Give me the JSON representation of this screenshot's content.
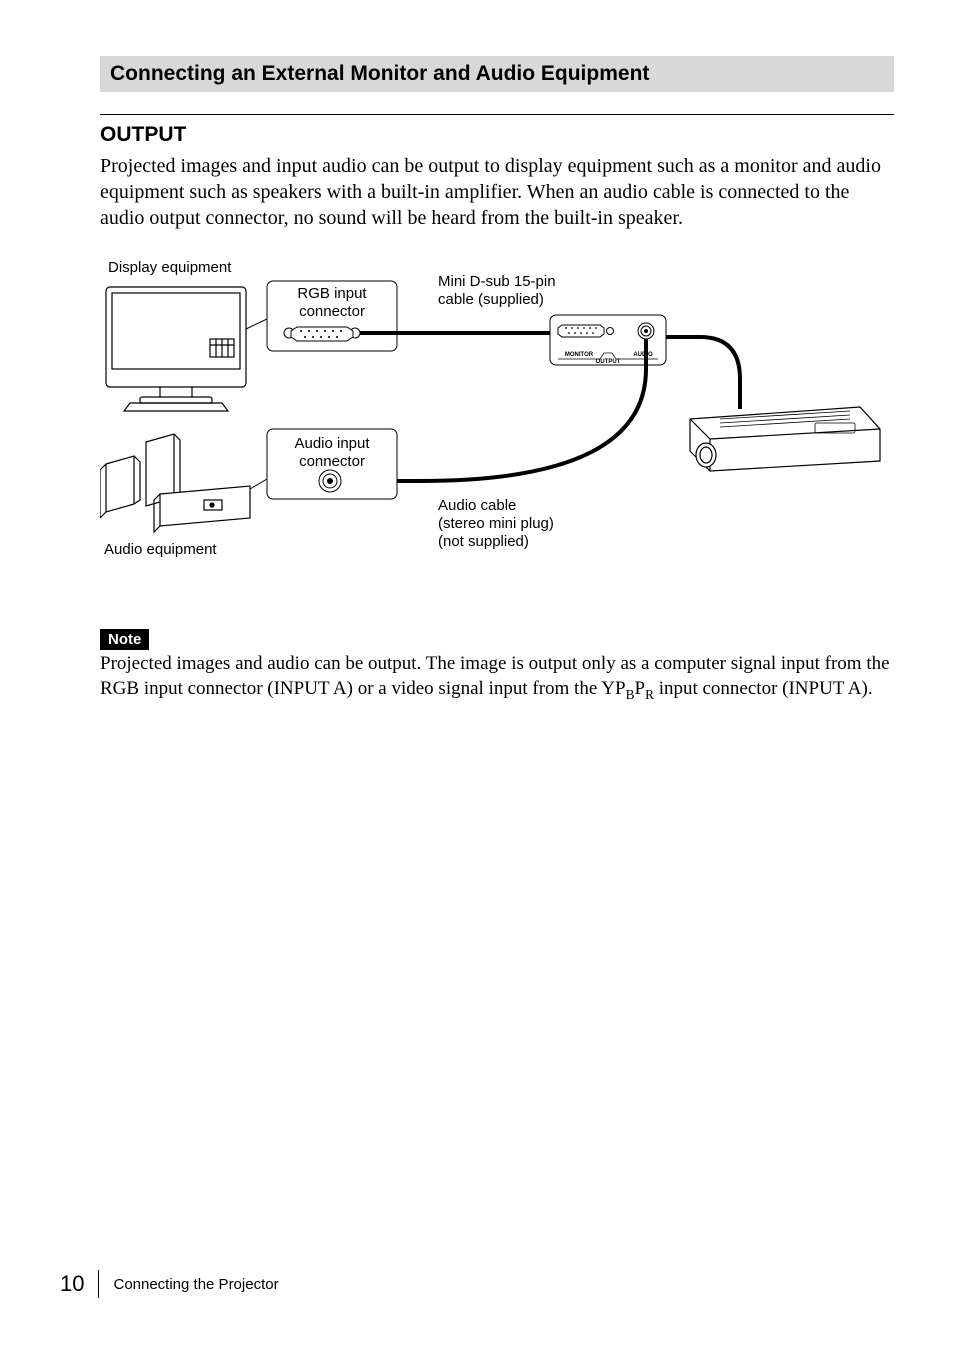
{
  "section_title": "Connecting an External Monitor and Audio Equipment",
  "sub_heading": "OUTPUT",
  "paragraph": "Projected images and input audio can be output to display equipment such as a monitor and audio equipment such as speakers with a built-in amplifier. When an audio cable is connected to the audio output connector, no sound will be heard from the built-in speaker.",
  "labels": {
    "display_eq": "Display equipment",
    "rgb_input_l1": "RGB input",
    "rgb_input_l2": "connector",
    "mini_dsub_l1": "Mini D-sub 15-pin",
    "mini_dsub_l2": "cable (supplied)",
    "audio_input_l1": "Audio input",
    "audio_input_l2": "connector",
    "audio_cable_l1": "Audio cable",
    "audio_cable_l2": "(stereo mini plug)",
    "audio_cable_l3": "(not supplied)",
    "audio_eq": "Audio equipment",
    "monitor_txt": "MONITOR",
    "output_txt": "OUTPUT",
    "audio_txt": "AUDIO"
  },
  "note_chip": "Note",
  "note_text_pre": "Projected images and audio can be output. The image is output only as a computer signal input from the RGB input connector (INPUT A) or a video signal input from the YP",
  "note_text_b": "B",
  "note_text_mid": "P",
  "note_text_r": "R",
  "note_text_post": " input connector (INPUT A).",
  "footer": {
    "page_num": "10",
    "section": "Connecting the Projector"
  }
}
